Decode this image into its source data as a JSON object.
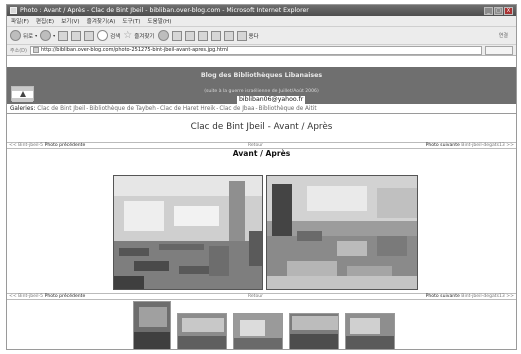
{
  "window": {
    "title": "Photo : Avant / Après - Clac de Bint Jbeil - bibliban.over-blog.com - Microsoft Internet Explorer",
    "buttons": [
      "_",
      "□",
      "X"
    ]
  },
  "menu": {
    "items": [
      "파일(F)",
      "편집(E)",
      "보기(V)",
      "즐겨찾기(A)",
      "도구(T)",
      "도움말(H)"
    ]
  },
  "toolbar": {
    "back_label": "뒤로",
    "search_label": "검색",
    "favorites_label": "즐겨찾기",
    "end_label": "연결",
    "extra_label": "용다"
  },
  "address": {
    "label": "주소(D)",
    "url": "http://bibliban.over-blog.com/photo-251275-bint-jbeil-avant-apres.jpg.html"
  },
  "blog": {
    "title": "Blog des Bibliothèques Libanaises",
    "subtitle": "(suite à la guerre israélienne de Juillet/Août 2006)",
    "email": "bibliban06@yahoo.fr"
  },
  "galleries": {
    "label": "Galeries:",
    "links": [
      "Clac de Bint Jbeil",
      "Bibliothèque de Taybeh",
      "Clac de Haret Hreik",
      "Clac de Jbaa",
      "Bibliothèque de Aitit"
    ],
    "separator": "-"
  },
  "page": {
    "title": "Clac de Bint Jbeil - Avant / Après",
    "photo_title": "Avant / Après"
  },
  "nav": {
    "prev_link": "<< Bint-jbeil-5",
    "prev_label": "Photo précédente",
    "back_label": "Retour",
    "next_label": "Photo suivante",
    "next_link": "Bint-jbeil-degats13 >>"
  }
}
